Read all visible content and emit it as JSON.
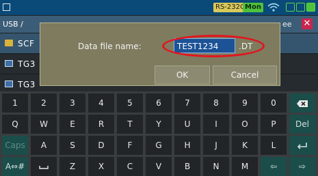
{
  "status_bar": {
    "badges": [
      {
        "label": "RS-232C",
        "color": "#d9c85a"
      },
      {
        "label": "Mon",
        "color": "#4fc23c"
      }
    ],
    "icons": [
      "wifi-icon",
      "status-icon",
      "status-icon",
      "status-icon"
    ]
  },
  "path_bar": {
    "path": "USB /",
    "tail": "ee"
  },
  "file_list": [
    {
      "name": "SCF",
      "icon": "folder-icon"
    },
    {
      "name": "TG3",
      "icon": "data-file-icon"
    },
    {
      "name": "TG3",
      "icon": "data-file-icon"
    }
  ],
  "dialog": {
    "label": "Data file name:",
    "input_value": "TEST1234",
    "extension": ".DT",
    "ok_label": "OK",
    "cancel_label": "Cancel",
    "highlight_color": "#e4141d"
  },
  "keyboard": {
    "rows": [
      [
        "1",
        "2",
        "3",
        "4",
        "5",
        "6",
        "7",
        "8",
        "9",
        "0",
        "backspace"
      ],
      [
        "Q",
        "W",
        "E",
        "R",
        "T",
        "Y",
        "U",
        "I",
        "O",
        "P",
        "Del"
      ],
      [
        "Caps",
        "A",
        "S",
        "D",
        "F",
        "G",
        "H",
        "J",
        "K",
        "L",
        "enter"
      ],
      [
        "A⇔#",
        "space",
        "Z",
        "X",
        "C",
        "V",
        "B",
        "N",
        "M",
        "⇦",
        "⇨"
      ]
    ]
  }
}
